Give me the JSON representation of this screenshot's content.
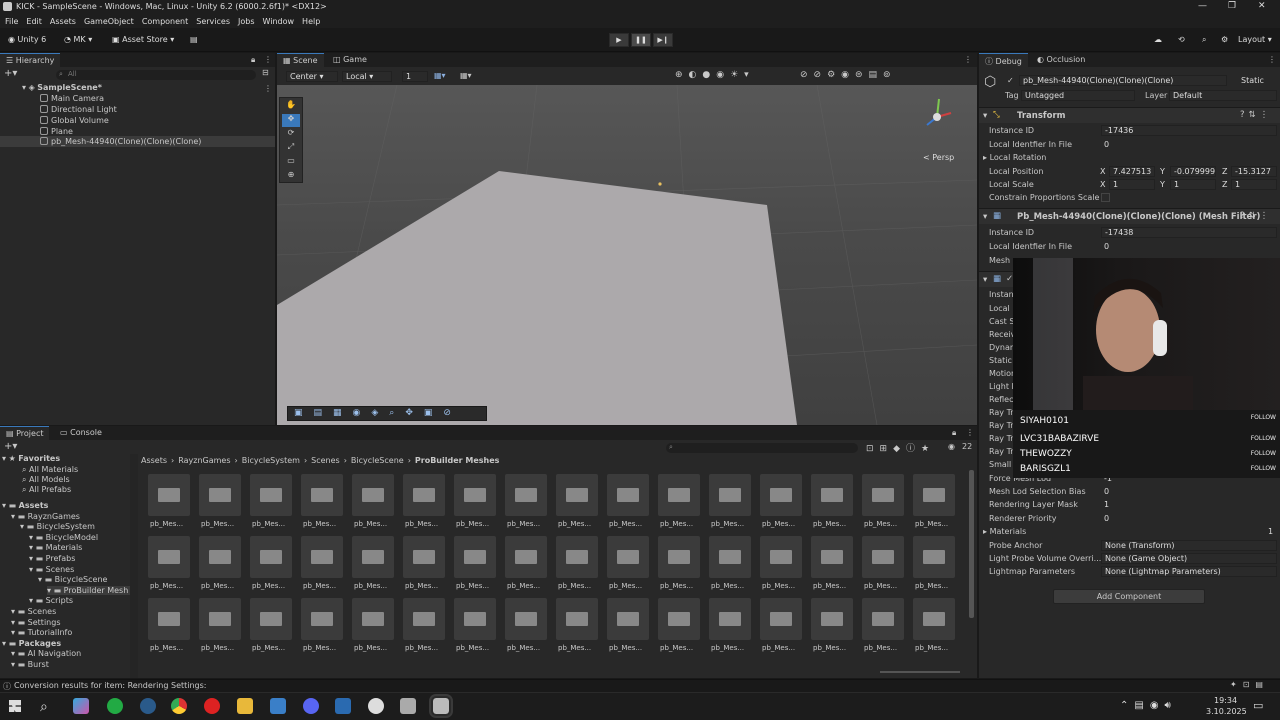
{
  "window": {
    "title": "KICK - SampleScene - Windows, Mac, Linux - Unity 6.2 (6000.2.6f1)* <DX12>",
    "controls": [
      "—",
      "❐",
      "✕"
    ]
  },
  "menu": [
    "File",
    "Edit",
    "Assets",
    "GameObject",
    "Component",
    "Services",
    "Jobs",
    "Window",
    "Help"
  ],
  "toolbar": {
    "unity_label": "Unity 6",
    "account_label": "MK",
    "asset_store_label": "Asset Store",
    "layout_label": "Layout"
  },
  "hierarchy": {
    "tab": "Hierarchy",
    "search_placeholder": "All",
    "scene": "SampleScene*",
    "items": [
      "Main Camera",
      "Directional Light",
      "Global Volume",
      "Plane",
      "pb_Mesh-44940(Clone)(Clone)(Clone)"
    ]
  },
  "scene": {
    "tabs": [
      "Scene",
      "Game"
    ],
    "pivot": "Center",
    "space": "Local",
    "grid_num": "1",
    "persp_label": "< Persp"
  },
  "inspector": {
    "tabs": [
      "Debug",
      "Occlusion"
    ],
    "object_name": "pb_Mesh-44940(Clone)(Clone)(Clone)",
    "static_label": "Static",
    "tag_label": "Tag",
    "tag_value": "Untagged",
    "layer_label": "Layer",
    "layer_value": "Default",
    "transform": {
      "title": "Transform",
      "instance_id_label": "Instance ID",
      "instance_id": "-17436",
      "local_identifier_label": "Local Identfier In File",
      "local_identifier": "0",
      "local_rotation_label": "Local Rotation",
      "local_position_label": "Local Position",
      "pos_x": "7.427513",
      "pos_y": "-0.0799999",
      "pos_z": "-15.3127",
      "local_scale_label": "Local Scale",
      "scale_x": "1",
      "scale_y": "1",
      "scale_z": "1",
      "constrain_label": "Constrain Proportions Scale"
    },
    "mesh_filter": {
      "title": "Pb_Mesh-44940(Clone)(Clone)(Clone) (Mesh Filter)",
      "instance_id_label": "Instance ID",
      "instance_id": "-17438",
      "local_identifier_label": "Local Identfier In File",
      "local_identifier": "0",
      "mesh_label": "Mesh"
    },
    "renderer_labels": [
      "Instanc",
      "Local I",
      "Cast S",
      "Receiv",
      "Dynam",
      "Static S",
      "Motion",
      "Light P",
      "Reflect",
      "Ray Tra",
      "Ray Tra",
      "Ray Tra",
      "Ray Tra",
      "Small Mesh Culling"
    ],
    "renderer_fields": [
      {
        "label": "Force Mesh Lod",
        "value": "-1"
      },
      {
        "label": "Mesh Lod Selection Bias",
        "value": "0"
      },
      {
        "label": "Rendering Layer Mask",
        "value": "1"
      },
      {
        "label": "Renderer Priority",
        "value": "0"
      }
    ],
    "materials_label": "Materials",
    "materials_count": "1",
    "probe_fields": [
      {
        "label": "Probe Anchor",
        "value": "None (Transform)"
      },
      {
        "label": "Light Probe Volume Overri...",
        "value": "None (Game Object)"
      },
      {
        "label": "Lightmap Parameters",
        "value": "None (Lightmap Parameters)"
      }
    ],
    "add_component_label": "Add Component"
  },
  "stream_overlay": {
    "viewers": [
      {
        "name": "SIYAH0101",
        "action": "FOLLOW"
      },
      {
        "name": "LVC31BABAZIRVE",
        "action": "FOLLOW"
      },
      {
        "name": "THEWOZZY",
        "action": "FOLLOW"
      },
      {
        "name": "BARISGZL1",
        "action": "FOLLOW"
      }
    ]
  },
  "project": {
    "tabs": [
      "Project",
      "Console"
    ],
    "badge_count": "22",
    "favorites_label": "Favorites",
    "favorites": [
      "All Materials",
      "All Models",
      "All Prefabs"
    ],
    "tree": [
      {
        "label": "Assets",
        "depth": 0,
        "bold": true
      },
      {
        "label": "RayznGames",
        "depth": 1
      },
      {
        "label": "BicycleSystem",
        "depth": 2
      },
      {
        "label": "BicycleModel",
        "depth": 3
      },
      {
        "label": "Materials",
        "depth": 3
      },
      {
        "label": "Prefabs",
        "depth": 3
      },
      {
        "label": "Scenes",
        "depth": 3
      },
      {
        "label": "BicycleScene",
        "depth": 4
      },
      {
        "label": "ProBuilder Mesh",
        "depth": 5,
        "selected": true
      },
      {
        "label": "Scripts",
        "depth": 3
      },
      {
        "label": "Scenes",
        "depth": 1
      },
      {
        "label": "Settings",
        "depth": 1
      },
      {
        "label": "TutorialInfo",
        "depth": 1
      },
      {
        "label": "Packages",
        "depth": 0,
        "bold": true
      },
      {
        "label": "AI Navigation",
        "depth": 1
      },
      {
        "label": "Burst",
        "depth": 1
      }
    ],
    "breadcrumb": [
      "Assets",
      "RayznGames",
      "BicycleSystem",
      "Scenes",
      "BicycleScene",
      "ProBuilder Meshes"
    ],
    "asset_label": "pb_Mes...",
    "grid_rows": 3,
    "grid_cols": 16
  },
  "status": {
    "message": "Conversion results for item: Rendering Settings:"
  },
  "taskbar": {
    "time": "19:34",
    "date": "3.10.2025"
  }
}
